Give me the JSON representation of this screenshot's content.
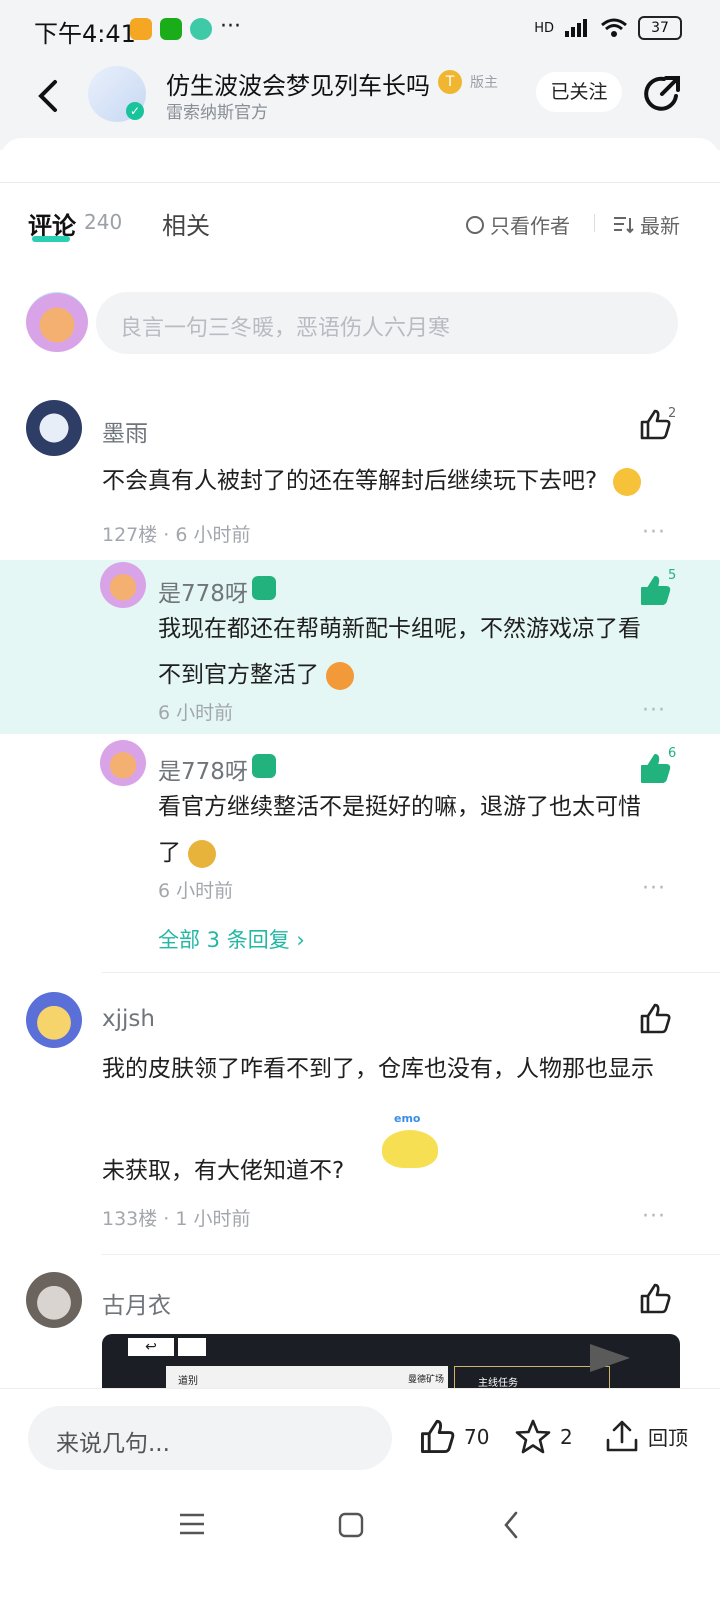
{
  "status": {
    "time": "下午4:41",
    "network": "HD",
    "battery": "37",
    "more": "···"
  },
  "header": {
    "title": "仿生波波会梦见列车长吗",
    "role_tag": "版主",
    "subtitle": "雷索纳斯官方",
    "follow_label": "已关注",
    "badge_letter": "T"
  },
  "tabs": {
    "comments_label": "评论",
    "comments_count": "240",
    "related_label": "相关",
    "author_only_label": "只看作者",
    "sort_label": "最新"
  },
  "composer": {
    "placeholder": "良言一句三冬暖，恶语伤人六月寒"
  },
  "comments": [
    {
      "user": "墨雨",
      "text": "不会真有人被封了的还在等解封后继续玩下去吧?",
      "meta": "127楼 · 6 小时前",
      "likes": "2",
      "more": "···",
      "replies": [
        {
          "user": "是778呀",
          "text_line1": "我现在都还在帮萌新配卡组呢，不然游戏凉了看",
          "text_line2": "不到官方整活了",
          "time": "6 小时前",
          "likes": "5",
          "more": "···"
        },
        {
          "user": "是778呀",
          "text_line1": "看官方继续整活不是挺好的嘛，退游了也太可惜",
          "text_line2": "了",
          "time": "6 小时前",
          "likes": "6",
          "more": "···"
        }
      ],
      "all_replies": "全部 3 条回复 ›"
    },
    {
      "user": "xjjsh",
      "text_line1": "我的皮肤领了咋看不到了，仓库也没有，人物那也显示",
      "text_line2": "未获取，有大佬知道不?",
      "meta": "133楼 · 1 小时前",
      "sticker_text": "emo",
      "more": "···"
    },
    {
      "user": "古月衣",
      "image_labels": {
        "road": "道别",
        "location": "曼德矿场",
        "task": "主线任务"
      }
    }
  ],
  "bottom_bar": {
    "say_placeholder": "来说几句...",
    "likes": "70",
    "stars": "2",
    "top_label": "回顶"
  },
  "colors": {
    "accent": "#2ad0b4",
    "like_active": "#21b27d",
    "reply_highlight": "#e4f7f4"
  }
}
